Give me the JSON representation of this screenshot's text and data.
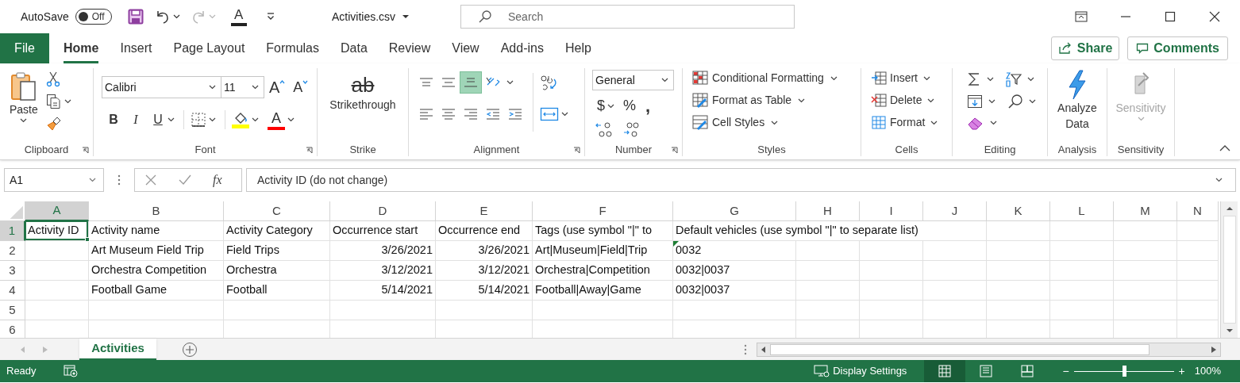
{
  "title_bar": {
    "autosave_label": "AutoSave",
    "autosave": {
      "label": "Off",
      "on": false
    },
    "quick_access": [
      {
        "kind": "save",
        "disabled": false
      },
      {
        "kind": "undo",
        "disabled": false
      },
      {
        "kind": "redo",
        "disabled": true
      },
      {
        "kind": "font_color",
        "glyph": "A",
        "disabled": false
      },
      {
        "kind": "customize",
        "disabled": false
      }
    ],
    "document_title": "Activities.csv",
    "search_placeholder": "Search"
  },
  "file_tab": "File",
  "tabs": [
    {
      "label": "Home",
      "selected": true
    },
    {
      "label": "Insert",
      "selected": false
    },
    {
      "label": "Page Layout",
      "selected": false
    },
    {
      "label": "Formulas",
      "selected": false
    },
    {
      "label": "Data",
      "selected": false
    },
    {
      "label": "Review",
      "selected": false
    },
    {
      "label": "View",
      "selected": false
    },
    {
      "label": "Add-ins",
      "selected": false
    },
    {
      "label": "Help",
      "selected": false
    }
  ],
  "share_button": "Share",
  "comments_button": "Comments",
  "ribbon": {
    "clipboard": {
      "label": "Clipboard",
      "paste": "Paste"
    },
    "font": {
      "label": "Font",
      "font_name": "Calibri",
      "font_size": "11",
      "grow_glyph": "A",
      "shrink_glyph": "A",
      "bold": "B",
      "italic": "I",
      "underline": "U",
      "font_color_glyph": "A"
    },
    "strike": {
      "label": "Strike",
      "glyph": "ab",
      "button": "Strikethrough"
    },
    "alignment": {
      "label": "Alignment",
      "buttons": [
        {
          "kind": "top",
          "selected": false
        },
        {
          "kind": "middle",
          "selected": false
        },
        {
          "kind": "bottom",
          "selected": true
        },
        {
          "kind": "orientation",
          "selected": false
        },
        {
          "kind": "left",
          "selected": false
        },
        {
          "kind": "center",
          "selected": false
        },
        {
          "kind": "right",
          "selected": false
        },
        {
          "kind": "outdent",
          "selected": false
        },
        {
          "kind": "indent",
          "selected": false
        }
      ]
    },
    "number": {
      "label": "Number",
      "format": "General",
      "currency": "$",
      "percent": "%",
      "comma": ","
    },
    "styles": {
      "label": "Styles",
      "buttons": [
        "Conditional Formatting",
        "Format as Table",
        "Cell Styles"
      ]
    },
    "cells": {
      "label": "Cells",
      "buttons": [
        "Insert",
        "Delete",
        "Format"
      ]
    },
    "editing": {
      "label": "Editing"
    },
    "analysis": {
      "label": "Analysis",
      "button": "Analyze Data"
    },
    "sensitivity": {
      "label": "Sensitivity",
      "button": "Sensitivity",
      "disabled": true
    }
  },
  "formula_bar": {
    "name_box": "A1",
    "fx": "fx",
    "formula": "Activity ID (do not change)"
  },
  "sheet": {
    "columns": [
      {
        "label": "A",
        "selected": true
      },
      {
        "label": "B",
        "selected": false
      },
      {
        "label": "C",
        "selected": false
      },
      {
        "label": "D",
        "selected": false
      },
      {
        "label": "E",
        "selected": false
      },
      {
        "label": "F",
        "selected": false
      },
      {
        "label": "G",
        "selected": false
      },
      {
        "label": "H",
        "selected": false
      },
      {
        "label": "I",
        "selected": false
      },
      {
        "label": "J",
        "selected": false
      },
      {
        "label": "K",
        "selected": false
      },
      {
        "label": "L",
        "selected": false
      },
      {
        "label": "M",
        "selected": false
      },
      {
        "label": "N",
        "selected": false
      }
    ],
    "rows": [
      {
        "label": "1",
        "selected": true,
        "cells": [
          {
            "text": "Activity ID",
            "kind": "text",
            "selected": true,
            "flagged": false
          },
          {
            "text": "Activity name",
            "kind": "text",
            "selected": false,
            "flagged": false
          },
          {
            "text": "Activity Category",
            "kind": "text",
            "selected": false,
            "flagged": false
          },
          {
            "text": "Occurrence start",
            "kind": "text",
            "selected": false,
            "flagged": false
          },
          {
            "text": "Occurrence end",
            "kind": "text",
            "selected": false,
            "flagged": false
          },
          {
            "text": "Tags (use symbol \"|\" to",
            "kind": "text",
            "selected": false,
            "flagged": false
          },
          {
            "text": "Default vehicles (use symbol \"|\" to separate list)",
            "kind": "text",
            "selected": false,
            "flagged": false
          }
        ]
      },
      {
        "label": "2",
        "selected": false,
        "cells": [
          {
            "kind": "empty"
          },
          {
            "text": "Art Museum Field Trip",
            "kind": "text",
            "selected": false,
            "flagged": false
          },
          {
            "text": "Field Trips",
            "kind": "text",
            "selected": false,
            "flagged": false
          },
          {
            "text": "3/26/2021",
            "kind": "number",
            "selected": false,
            "flagged": false
          },
          {
            "text": "3/26/2021",
            "kind": "number",
            "selected": false,
            "flagged": false
          },
          {
            "text": "Art|Museum|Field|Trip",
            "kind": "text",
            "selected": false,
            "flagged": false
          },
          {
            "text": "0032",
            "kind": "text",
            "selected": false,
            "flagged": true
          }
        ]
      },
      {
        "label": "3",
        "selected": false,
        "cells": [
          {
            "kind": "empty"
          },
          {
            "text": "Orchestra Competition",
            "kind": "text",
            "selected": false,
            "flagged": false
          },
          {
            "text": "Orchestra",
            "kind": "text",
            "selected": false,
            "flagged": false
          },
          {
            "text": "3/12/2021",
            "kind": "number",
            "selected": false,
            "flagged": false
          },
          {
            "text": "3/12/2021",
            "kind": "number",
            "selected": false,
            "flagged": false
          },
          {
            "text": "Orchestra|Competition",
            "kind": "text",
            "selected": false,
            "flagged": false
          },
          {
            "text": "0032|0037",
            "kind": "text",
            "selected": false,
            "flagged": false
          }
        ]
      },
      {
        "label": "4",
        "selected": false,
        "cells": [
          {
            "kind": "empty"
          },
          {
            "text": "Football Game",
            "kind": "text",
            "selected": false,
            "flagged": false
          },
          {
            "text": "Football",
            "kind": "text",
            "selected": false,
            "flagged": false
          },
          {
            "text": "5/14/2021",
            "kind": "number",
            "selected": false,
            "flagged": false
          },
          {
            "text": "5/14/2021",
            "kind": "number",
            "selected": false,
            "flagged": false
          },
          {
            "text": "Football|Away|Game",
            "kind": "text",
            "selected": false,
            "flagged": false
          },
          {
            "text": "0032|0037",
            "kind": "text",
            "selected": false,
            "flagged": false
          }
        ]
      },
      {
        "label": "5",
        "selected": false
      },
      {
        "label": "6",
        "selected": false
      }
    ]
  },
  "sheet_tabs": [
    {
      "label": "Activities",
      "selected": true
    }
  ],
  "status_bar": {
    "status": "Ready",
    "display_settings": "Display Settings",
    "views": [
      {
        "kind": "normal",
        "selected": true
      },
      {
        "kind": "page_layout",
        "selected": false
      },
      {
        "kind": "page_break",
        "selected": false
      }
    ],
    "zoom_out": "−",
    "zoom_in": "+",
    "zoom": {
      "level": 0.5
    },
    "zoom_label": "100%"
  }
}
